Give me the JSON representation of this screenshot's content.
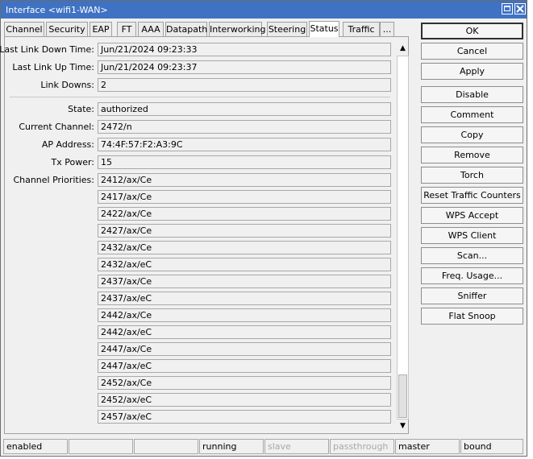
{
  "window": {
    "title": "Interface <wifi1-WAN>"
  },
  "tabs": [
    "Channel",
    "Security",
    "EAP",
    "FT",
    "AAA",
    "Datapath",
    "Interworking",
    "Steering",
    "Status",
    "Traffic",
    "..."
  ],
  "active_tab": "Status",
  "fields": {
    "last_link_down": {
      "label": "Last Link Down Time:",
      "value": "Jun/21/2024 09:23:33"
    },
    "last_link_up": {
      "label": "Last Link Up Time:",
      "value": "Jun/21/2024 09:23:37"
    },
    "link_downs": {
      "label": "Link Downs:",
      "value": "2"
    },
    "state": {
      "label": "State:",
      "value": "authorized"
    },
    "current_channel": {
      "label": "Current Channel:",
      "value": "2472/n"
    },
    "ap_address": {
      "label": "AP Address:",
      "value": "74:4F:57:F2:A3:9C"
    },
    "tx_power": {
      "label": "Tx Power:",
      "value": "15"
    }
  },
  "channel_priorities": {
    "label": "Channel Priorities:",
    "values": [
      "2412/ax/Ce",
      "2417/ax/Ce",
      "2422/ax/Ce",
      "2427/ax/Ce",
      "2432/ax/Ce",
      "2432/ax/eC",
      "2437/ax/Ce",
      "2437/ax/eC",
      "2442/ax/Ce",
      "2442/ax/eC",
      "2447/ax/Ce",
      "2447/ax/eC",
      "2452/ax/Ce",
      "2452/ax/eC",
      "2457/ax/eC"
    ]
  },
  "buttons": [
    "OK",
    "Cancel",
    "Apply",
    "Disable",
    "Comment",
    "Copy",
    "Remove",
    "Torch",
    "Reset Traffic Counters",
    "WPS Accept",
    "WPS Client",
    "Scan...",
    "Freq. Usage...",
    "Sniffer",
    "Flat Snoop"
  ],
  "status_bar": [
    "enabled",
    "",
    "",
    "running",
    "slave",
    "passthrough",
    "master",
    "bound"
  ],
  "status_dim": [
    false,
    false,
    false,
    false,
    true,
    true,
    false,
    false
  ]
}
